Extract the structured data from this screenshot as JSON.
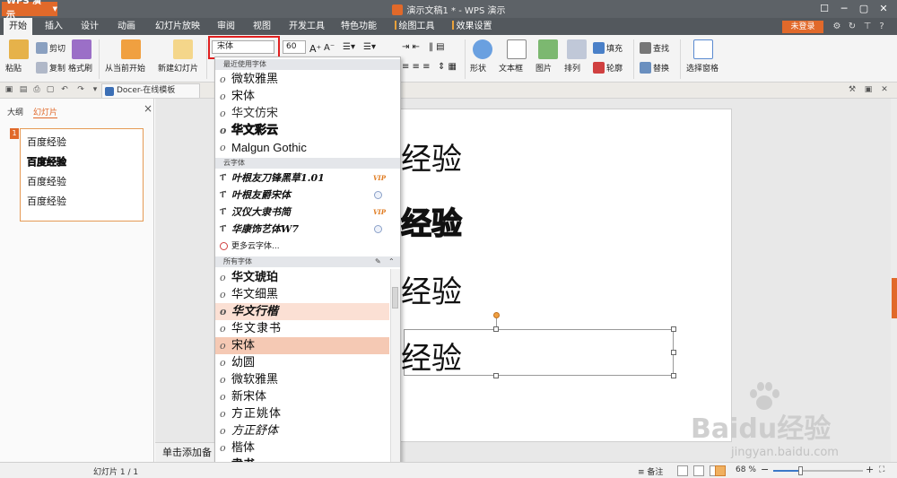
{
  "app": {
    "menu_button": "WPS 演示",
    "window_title": "演示文稿1 * - WPS 演示"
  },
  "menu_tabs": [
    "开始",
    "插入",
    "设计",
    "动画",
    "幻灯片放映",
    "审阅",
    "视图",
    "开发工具",
    "特色功能",
    "绘图工具",
    "效果设置"
  ],
  "login_label": "未登录",
  "ribbon": {
    "paste": "粘贴",
    "cut": "剪切",
    "copy": "复制",
    "format_painter": "格式刷",
    "from_current": "从当前开始",
    "new_slide": "新建幻灯片",
    "font_name": "宋体",
    "font_size": "60",
    "shape": "形状",
    "textbox": "文本框",
    "picture": "图片",
    "arrange": "排列",
    "fill": "填充",
    "outline": "轮廓",
    "find": "查找",
    "replace": "替换",
    "selection_pane": "选择窗格"
  },
  "qat": {
    "docer_tab": "Docer-在线模板"
  },
  "left_pane": {
    "tab_outline": "大纲",
    "tab_slides": "幻灯片",
    "slide_number": "1",
    "thumb_lines": [
      "百度经验",
      "百度经验",
      "百度经验",
      "百度经验"
    ]
  },
  "slide": {
    "lines": [
      "经验",
      "经验",
      "经验",
      "经验"
    ]
  },
  "notes_placeholder": "单击添加备",
  "font_dropdown": {
    "recent_header": "最近使用字体",
    "recent": [
      "微软雅黑",
      "宋体",
      "华文仿宋",
      "华文彩云",
      "Malgun Gothic"
    ],
    "cloud_header": "云字体",
    "cloud": [
      {
        "name": "叶根友刀锋黑草1.01",
        "badge": "VIP"
      },
      {
        "name": "叶根友爵宋体",
        "badge": "download"
      },
      {
        "name": "汉仪大隶书简",
        "badge": "VIP"
      },
      {
        "name": "华康饰艺体W7",
        "badge": "download"
      }
    ],
    "more_cloud": "更多云字体...",
    "all_header": "所有字体",
    "all": [
      "华文琥珀",
      "华文细黑",
      "华文行楷",
      "华文隶书",
      "宋体",
      "幼圆",
      "微软雅黑",
      "新宋体",
      "方正姚体",
      "方正舒体",
      "楷体",
      "隶书"
    ],
    "hover_item": "华文行楷",
    "selected_item": "宋体"
  },
  "status": {
    "slide_count": "幻灯片 1 / 1",
    "notes": "备注",
    "zoom": "68 %"
  },
  "watermark": {
    "main": "Baidu经验",
    "sub": "jingyan.baidu.com"
  },
  "colors": {
    "accent": "#e1692a",
    "titlebar": "#5d6267",
    "selected_font": "#f5c9b4",
    "highlight_box": "#e02020"
  }
}
